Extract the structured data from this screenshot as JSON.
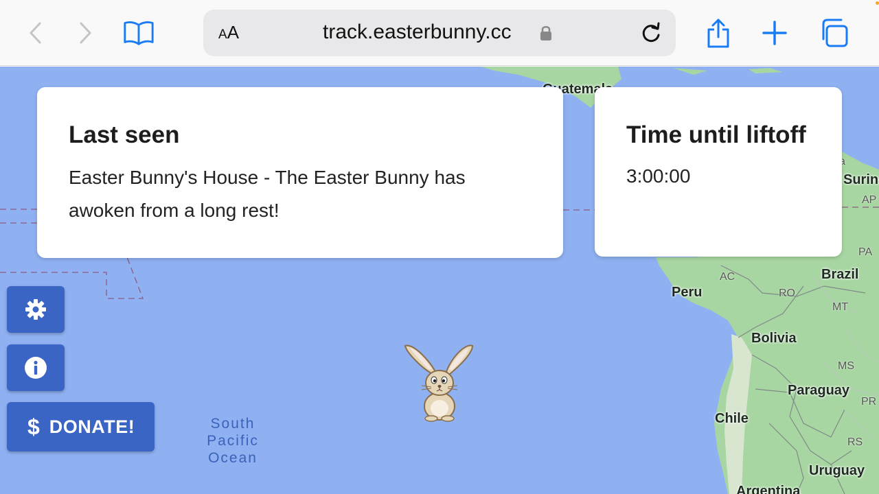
{
  "browser": {
    "url": "track.easterbunny.cc",
    "text_size_label_small": "A",
    "text_size_label_large": "A",
    "icons": [
      "back-icon",
      "forward-icon",
      "bookmarks-icon",
      "lock-icon",
      "reload-icon",
      "share-icon",
      "new-tab-icon",
      "tabs-icon"
    ]
  },
  "last_seen": {
    "title": "Last seen",
    "text": "Easter Bunny's House - The Easter Bunny has awoken from a long rest!"
  },
  "countdown": {
    "title": "Time until liftoff",
    "value": "3:00:00"
  },
  "controls": {
    "settings_icon": "gear-icon",
    "info_icon": "info-icon",
    "donate_symbol": "$",
    "donate_label": "DONATE!"
  },
  "map": {
    "labels": {
      "guatemala": "Guatemala",
      "suriname": "Suriname",
      "peru": "Peru",
      "brazil": "Brazil",
      "bolivia": "Bolivia",
      "paraguay": "Paraguay",
      "chile": "Chile",
      "uruguay": "Uruguay",
      "argentina": "Argentina",
      "ocean": "South Pacific Ocean"
    },
    "states": {
      "pa": "PA",
      "ac": "AC",
      "ro": "RO",
      "mt": "MT",
      "ms": "MS",
      "pr": "PR",
      "rs": "RS",
      "ap": "AP",
      "a": "a"
    },
    "colors": {
      "water": "#8fb1f2",
      "land": "#a8d6a2",
      "accent": "#3a65c4"
    }
  }
}
